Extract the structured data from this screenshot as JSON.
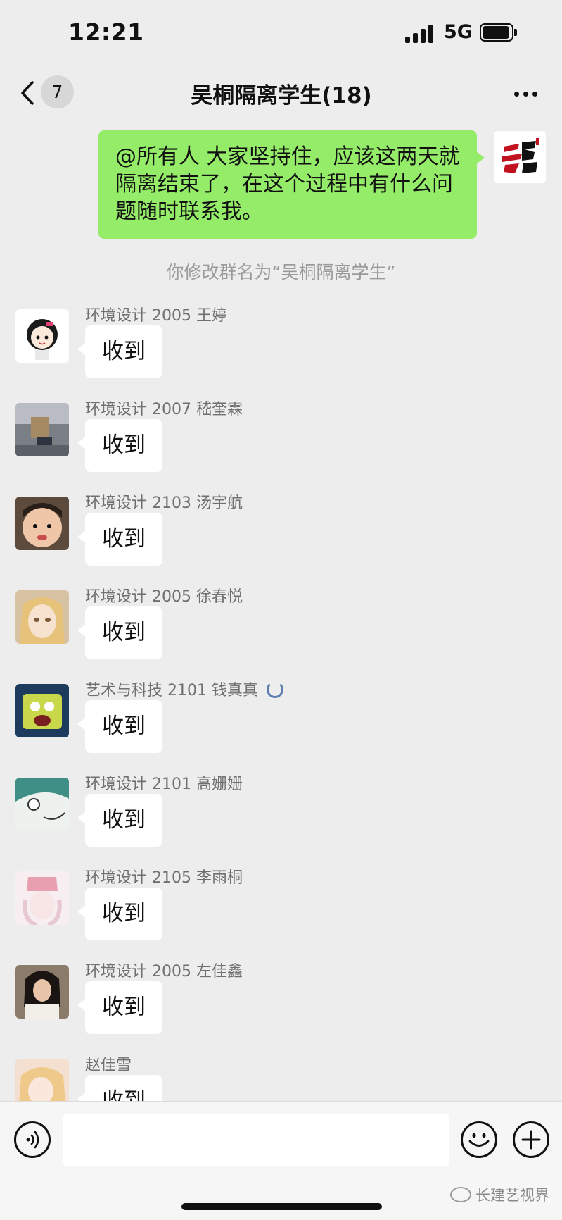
{
  "status_bar": {
    "time": "12:21",
    "network": "5G"
  },
  "nav": {
    "unread_count": "7",
    "title": "吴桐隔离学生(18)"
  },
  "self_message": {
    "text": "@所有人 大家坚持住，应该这两天就隔离结束了，在这个过程中有什么问题随时联系我。"
  },
  "system_note": "你修改群名为“吴桐隔离学生”",
  "messages": [
    {
      "sender": "环境设计 2005 王婷",
      "text": "收到"
    },
    {
      "sender": "环境设计 2007 嵇奎霖",
      "text": "收到"
    },
    {
      "sender": "环境设计 2103 汤宇航",
      "text": "收到"
    },
    {
      "sender": "环境设计 2005 徐春悦",
      "text": "收到"
    },
    {
      "sender": "艺术与科技 2101 钱真真",
      "text": "收到"
    },
    {
      "sender": "环境设计 2101 高姗姗",
      "text": "收到"
    },
    {
      "sender": "环境设计 2105 李雨桐",
      "text": "收到"
    },
    {
      "sender": "环境设计 2005 左佳鑫",
      "text": "收到"
    },
    {
      "sender": "赵佳雪",
      "text": "收到"
    }
  ],
  "watermark": "长建艺视界",
  "colors": {
    "background": "#ededed",
    "self_bubble": "#95ec69",
    "other_bubble": "#ffffff"
  }
}
